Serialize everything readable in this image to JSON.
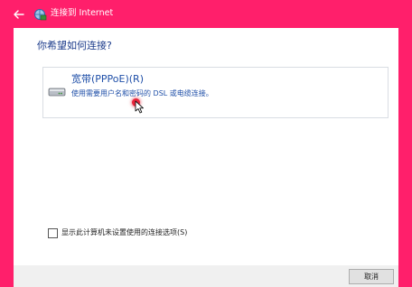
{
  "window": {
    "title": "连接到 Internet"
  },
  "main": {
    "heading": "你希望如何连接?",
    "option": {
      "title": "宽带(PPPoE)(R)",
      "description": "使用需要用户名和密码的 DSL 或电缆连接。",
      "icon": "modem-icon"
    }
  },
  "checkbox": {
    "label": "显示此计算机未设置使用的连接选项(S)",
    "checked": false
  },
  "footer": {
    "cancel_label": "取消"
  },
  "colors": {
    "titlebar": "#ff1f6b",
    "heading": "#1a3a8a",
    "link": "#1f4fa8",
    "cursor_highlight": "#e8243a"
  }
}
